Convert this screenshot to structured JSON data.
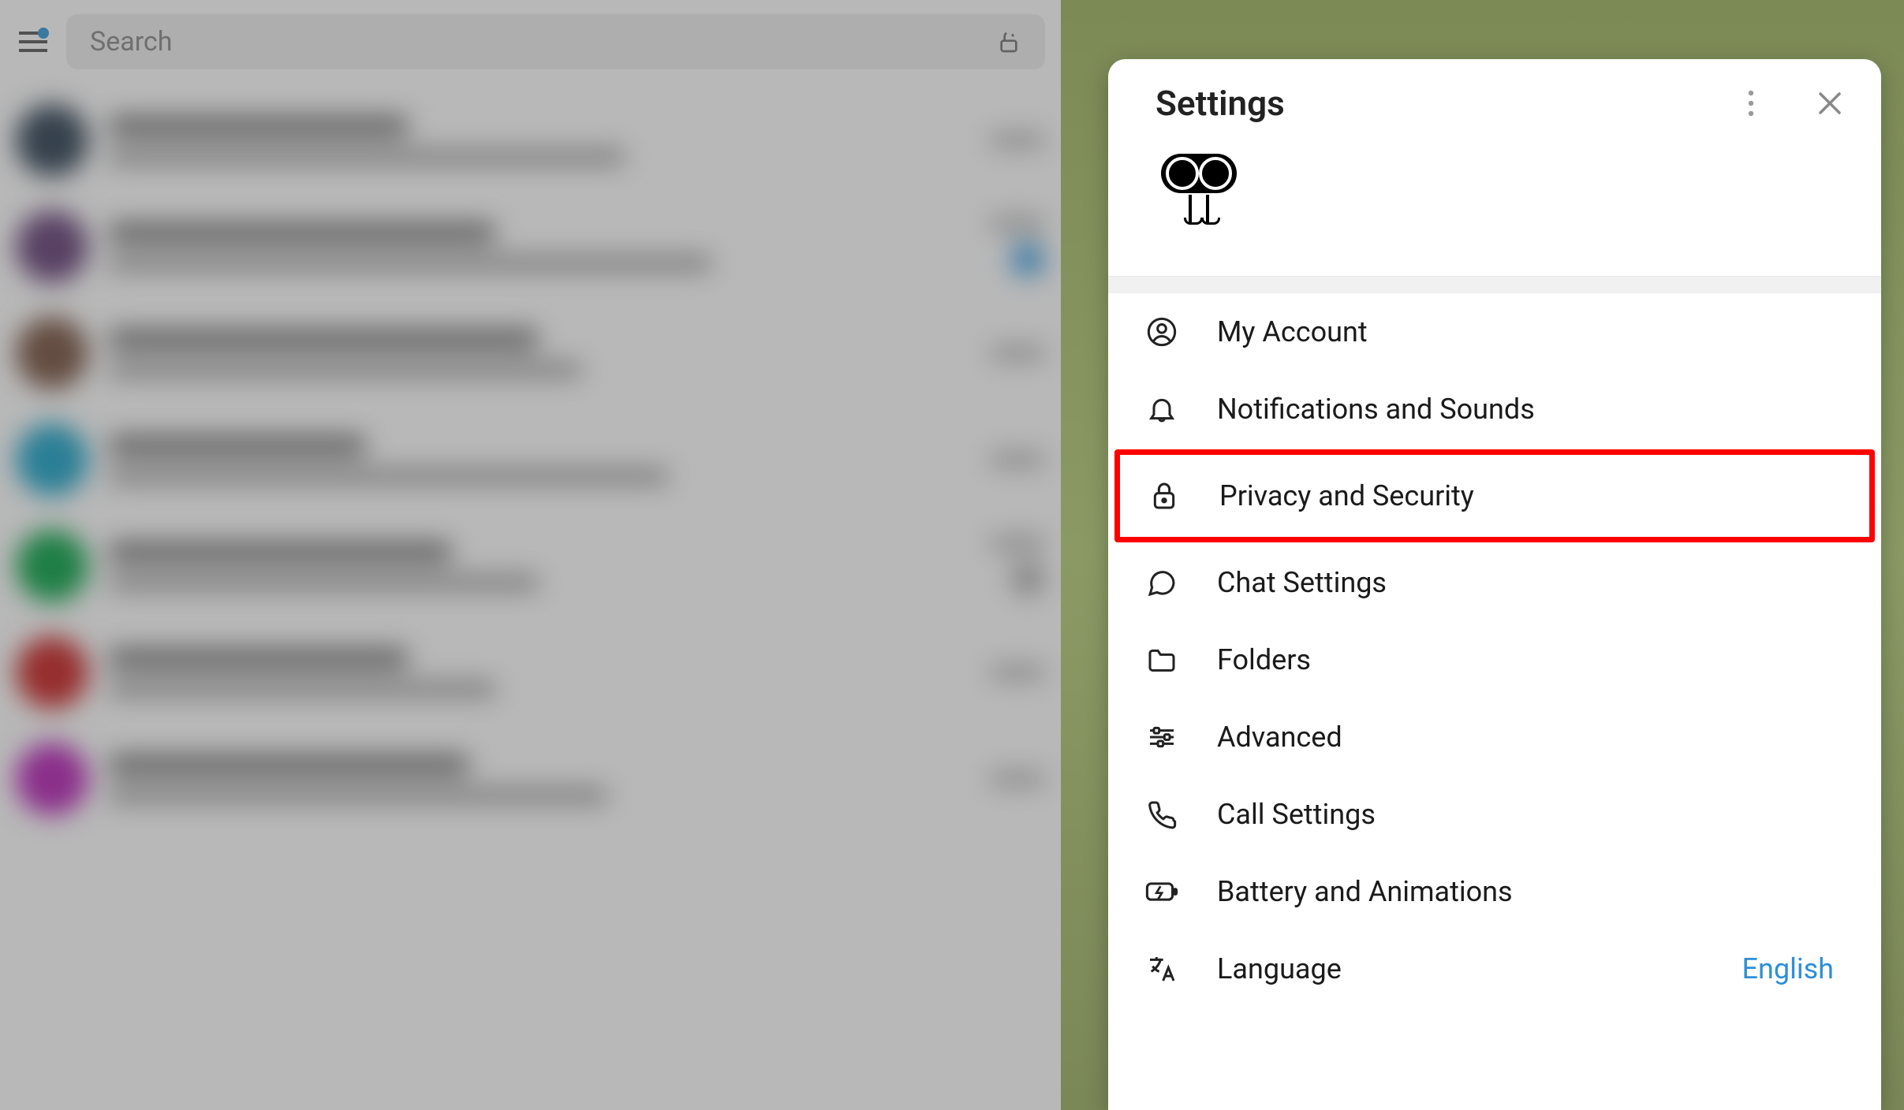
{
  "search": {
    "placeholder": "Search"
  },
  "settings": {
    "title": "Settings",
    "items": [
      {
        "label": "My Account",
        "icon": "account"
      },
      {
        "label": "Notifications and Sounds",
        "icon": "bell"
      },
      {
        "label": "Privacy and Security",
        "icon": "lock",
        "highlighted": true
      },
      {
        "label": "Chat Settings",
        "icon": "chat"
      },
      {
        "label": "Folders",
        "icon": "folder"
      },
      {
        "label": "Advanced",
        "icon": "sliders"
      },
      {
        "label": "Call Settings",
        "icon": "phone"
      },
      {
        "label": "Battery and Animations",
        "icon": "battery"
      },
      {
        "label": "Language",
        "icon": "language",
        "value": "English"
      }
    ]
  }
}
